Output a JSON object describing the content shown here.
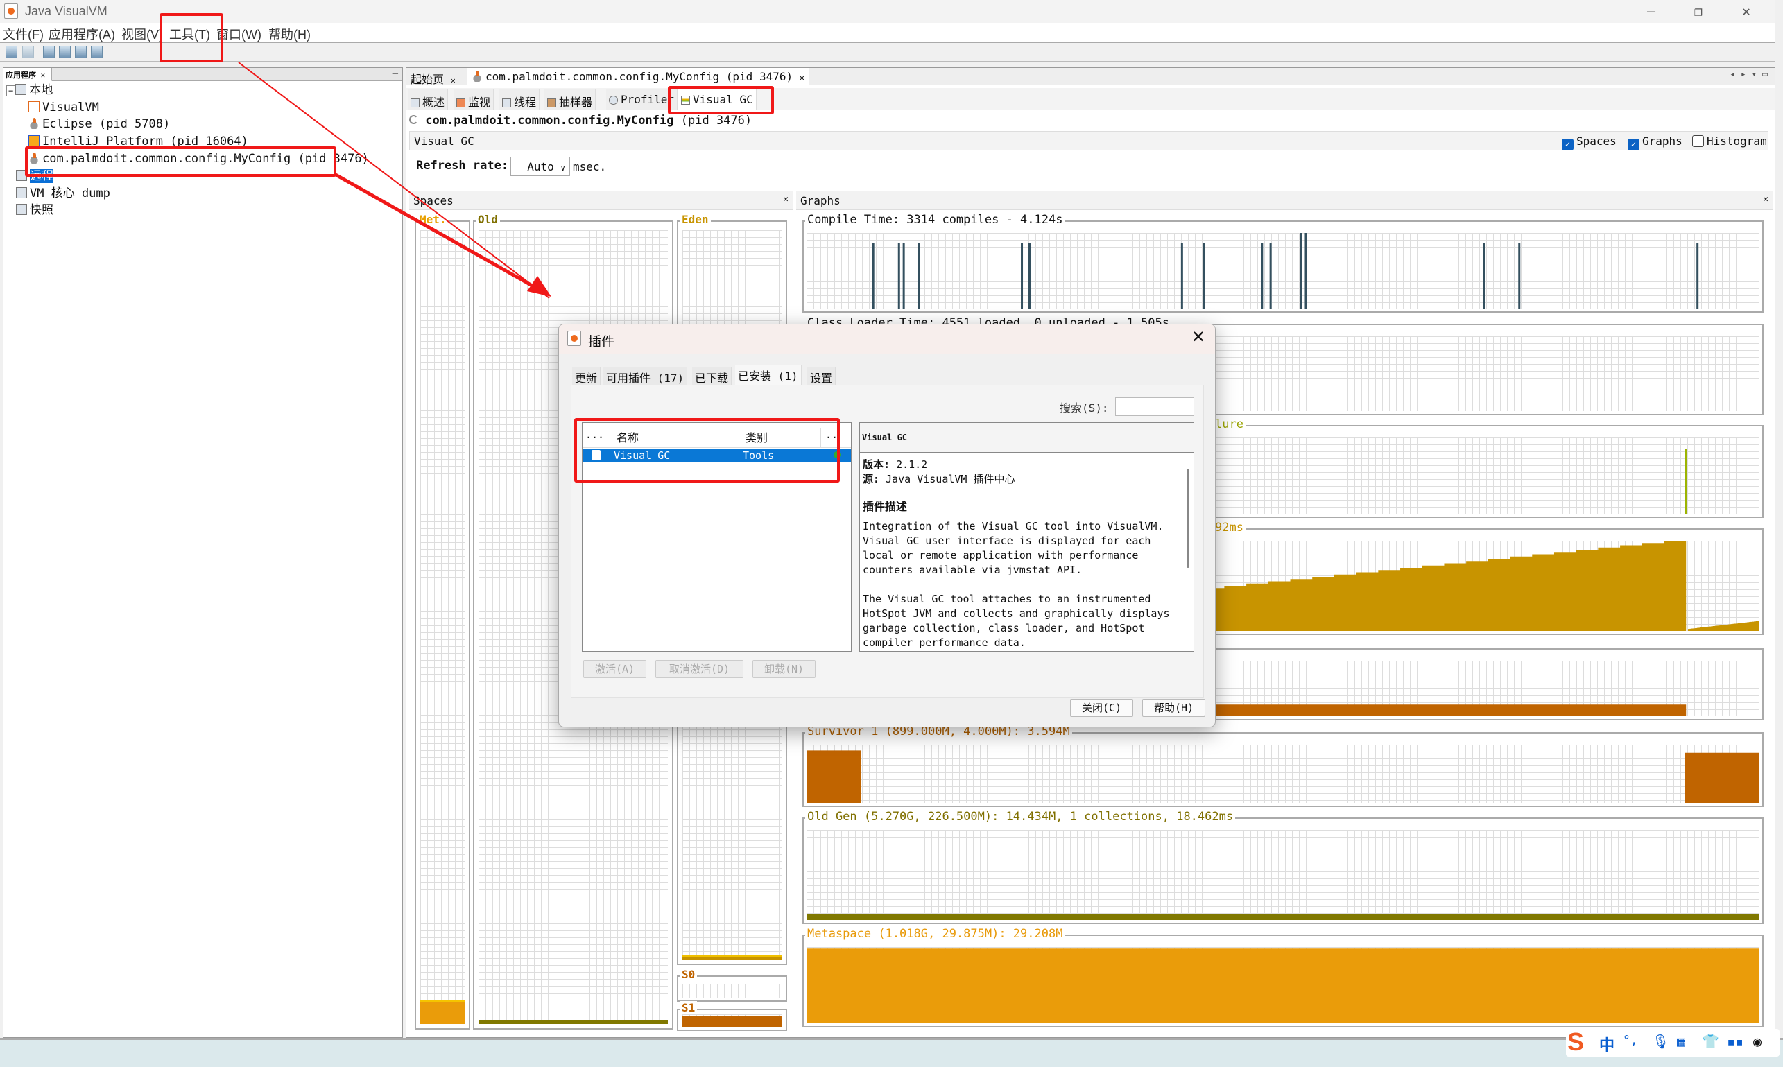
{
  "window": {
    "title": "Java VisualVM"
  },
  "menubar": [
    "文件(F)",
    "应用程序(A)",
    "视图(V)",
    "工具(T)",
    "窗口(W)",
    "帮助(H)"
  ],
  "left_panel": {
    "tab": "应用程序",
    "tree": {
      "local": "本地",
      "local_items": [
        "VisualVM",
        "Eclipse (pid 5708)",
        "IntelliJ Platform (pid 16064)",
        "com.palmdoit.common.config.MyConfig (pid 3476)"
      ],
      "remote": "远程",
      "core_dump": "VM 核心 dump",
      "snapshots": "快照"
    }
  },
  "doc_tabs": [
    "起始页",
    "com.palmdoit.common.config.MyConfig (pid 3476)"
  ],
  "sub_tabs": [
    "概述",
    "监视",
    "线程",
    "抽样器",
    "Profiler",
    "Visual GC"
  ],
  "app_heading": {
    "name": "com.palmdoit.common.config.MyConfig",
    "pid": "(pid 3476)"
  },
  "visual_gc": {
    "header": "Visual GC",
    "options": [
      {
        "label": "Spaces",
        "checked": true
      },
      {
        "label": "Graphs",
        "checked": true
      },
      {
        "label": "Histogram",
        "checked": false
      }
    ],
    "refresh_label": "Refresh rate:",
    "refresh_value": "Auto",
    "refresh_unit": "msec."
  },
  "spaces": {
    "title": "Spaces",
    "labels": {
      "metaspace": "Met.",
      "old": "Old",
      "eden": "Eden",
      "s0": "S0",
      "s1": "S1"
    },
    "fill": {
      "metaspace": 0.03,
      "old": 0.005,
      "eden": 0.005,
      "s0": 0.0,
      "s1": 0.9
    }
  },
  "graphs": {
    "title": "Graphs",
    "compile_title": "Compile Time: 3314 compiles - 4.124s",
    "classloader_title": "Class Loader Time: 4551 loaded, 0 unloaded - 1.505s",
    "gc_title_fragment": "lure",
    "eden_title_fragment": "92ms",
    "survivor1_title": "Survivor 1 (899.000M, 4.000M): 3.594M",
    "oldgen_title": "Old Gen (5.270G, 226.500M): 14.434M, 1 collections, 18.462ms",
    "metaspace_title": "Metaspace (1.018G, 29.875M): 29.208M"
  },
  "chart_data": [
    {
      "type": "bar",
      "name": "compile-time",
      "title": "Compile Time: 3314 compiles - 4.124s",
      "x_range": [
        0,
        1
      ],
      "y_range": [
        0,
        1
      ],
      "spikes": [
        [
          0.07,
          0.87
        ],
        [
          0.097,
          0.87
        ],
        [
          0.102,
          0.87
        ],
        [
          0.118,
          0.87
        ],
        [
          0.226,
          0.87
        ],
        [
          0.234,
          0.87
        ],
        [
          0.394,
          0.87
        ],
        [
          0.417,
          0.87
        ],
        [
          0.478,
          0.87
        ],
        [
          0.487,
          0.87
        ],
        [
          0.519,
          1.0
        ],
        [
          0.524,
          1.0
        ],
        [
          0.711,
          0.87
        ],
        [
          0.748,
          0.87
        ],
        [
          0.935,
          0.87
        ]
      ],
      "color": "#34505f"
    },
    {
      "type": "bar",
      "name": "gc-time",
      "x_range": [
        0,
        1
      ],
      "y_range": [
        0,
        1
      ],
      "spikes": [
        [
          0.923,
          0.85
        ]
      ],
      "color": "#9cb400"
    },
    {
      "type": "area",
      "name": "eden",
      "x_range": [
        0,
        1
      ],
      "y_range": [
        0,
        1
      ],
      "segments": [
        [
          0,
          0.923,
          0.0,
          1.0
        ],
        [
          0.925,
          1,
          0.02,
          0.11
        ]
      ],
      "color": "#c89400"
    },
    {
      "type": "area",
      "name": "survivor-0",
      "x_range": [
        0,
        1
      ],
      "y_range": [
        0,
        1
      ],
      "segments": [
        [
          0,
          0.923,
          0.21,
          0.21
        ]
      ],
      "color": "#c06400"
    },
    {
      "type": "area",
      "name": "survivor-1",
      "title": "Survivor 1 (899.000M, 4.000M): 3.594M",
      "x_range": [
        0,
        1
      ],
      "y_range": [
        0,
        1
      ],
      "segments": [
        [
          0,
          0.057,
          0.9,
          0.9
        ],
        [
          0.922,
          1,
          0.86,
          0.86
        ]
      ],
      "color": "#c06400"
    },
    {
      "type": "area",
      "name": "old-gen",
      "title": "Old Gen (5.270G, 226.500M): 14.434M, 1 collections, 18.462ms",
      "x_range": [
        0,
        1
      ],
      "y_range": [
        0,
        1
      ],
      "segments": [
        [
          0,
          1,
          0.065,
          0.065
        ]
      ],
      "color": "#807800"
    },
    {
      "type": "area",
      "name": "metaspace",
      "title": "Metaspace (1.018G, 29.875M): 29.208M",
      "x_range": [
        0,
        1
      ],
      "y_range": [
        0,
        1
      ],
      "segments": [
        [
          0,
          1,
          0.98,
          0.98
        ]
      ],
      "color": "#ea9c0a"
    }
  ],
  "dialog": {
    "title": "插件",
    "tabs": [
      "更新",
      "可用插件 (17)",
      "已下载",
      "已安装 (1)",
      "设置"
    ],
    "active_tab": 3,
    "search_label": "搜索(S):",
    "search_value": "",
    "columns": [
      "...",
      "名称",
      "类别",
      ".."
    ],
    "rows": [
      {
        "name": "Visual GC",
        "category": "Tools",
        "selected": true
      }
    ],
    "detail": {
      "header": "Visual GC",
      "version_label": "版本:",
      "version": "2.1.2",
      "source_label": "源:",
      "source": "Java VisualVM 插件中心",
      "desc_heading": "插件描述",
      "para1": "Integration of the Visual GC tool into VisualVM. Visual GC user interface is displayed for each local or remote application with performance counters available via jvmstat API.",
      "para2": "The Visual GC tool attaches to an instrumented HotSpot JVM and collects and graphically displays garbage collection, class loader, and HotSpot compiler performance data."
    },
    "buttons": [
      "激活(A)",
      "取消激活(D)",
      "卸载(N)"
    ],
    "close": "关闭(C)",
    "help": "帮助(H)"
  },
  "ime": [
    "中",
    "°,"
  ]
}
